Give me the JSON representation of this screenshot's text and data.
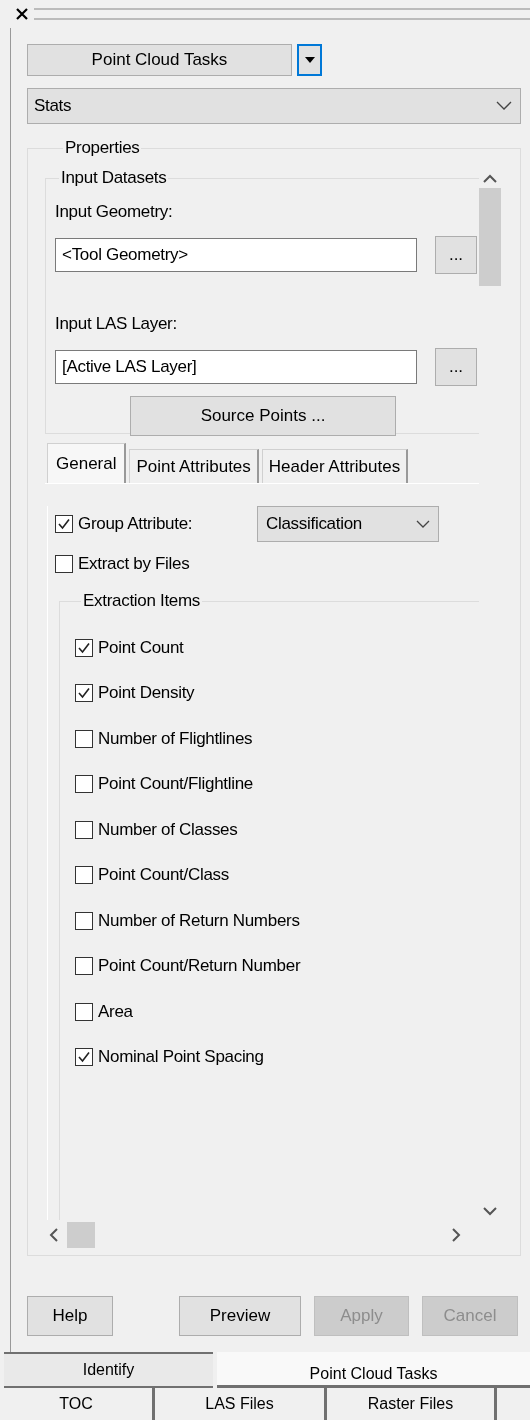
{
  "task_selector": {
    "label": "Point Cloud Tasks"
  },
  "task_combo": {
    "value": "Stats"
  },
  "properties": {
    "title": "Properties",
    "input_datasets": {
      "title": "Input Datasets",
      "fields": [
        {
          "label": "Input Geometry:",
          "value": "<Tool Geometry>",
          "browse": "..."
        },
        {
          "label": "Input LAS Layer:",
          "value": "[Active LAS Layer]",
          "browse": "..."
        }
      ],
      "source_button": "Source Points ..."
    },
    "tabs": [
      {
        "label": "General",
        "selected": true
      },
      {
        "label": "Point Attributes",
        "selected": false
      },
      {
        "label": "Header Attributes",
        "selected": false
      }
    ],
    "group_attribute": {
      "label": "Group Attribute:",
      "checked": true,
      "value": "Classification"
    },
    "extract_by_files": {
      "label": "Extract by Files",
      "checked": false
    },
    "extraction_items": {
      "title": "Extraction Items",
      "items": [
        {
          "label": "Point Count",
          "checked": true
        },
        {
          "label": "Point Density",
          "checked": true
        },
        {
          "label": "Number of Flightlines",
          "checked": false
        },
        {
          "label": "Point Count/Flightline",
          "checked": false
        },
        {
          "label": "Number of Classes",
          "checked": false
        },
        {
          "label": "Point Count/Class",
          "checked": false
        },
        {
          "label": "Number of Return Numbers",
          "checked": false
        },
        {
          "label": "Point Count/Return Number",
          "checked": false
        },
        {
          "label": "Area",
          "checked": false
        },
        {
          "label": "Nominal Point Spacing",
          "checked": true
        }
      ]
    }
  },
  "buttons": [
    {
      "label": "Help",
      "disabled": false
    },
    {
      "label": "Preview",
      "disabled": false
    },
    {
      "label": "Apply",
      "disabled": true
    },
    {
      "label": "Cancel",
      "disabled": true
    }
  ],
  "panel_tabs": {
    "row_1": [
      {
        "label": "Identify",
        "selected": false
      },
      {
        "label": "Point Cloud Tasks",
        "selected": true
      }
    ],
    "row_2": [
      {
        "label": "TOC",
        "selected": false
      },
      {
        "label": "LAS Files",
        "selected": false
      },
      {
        "label": "Raster Files",
        "selected": false
      }
    ]
  }
}
